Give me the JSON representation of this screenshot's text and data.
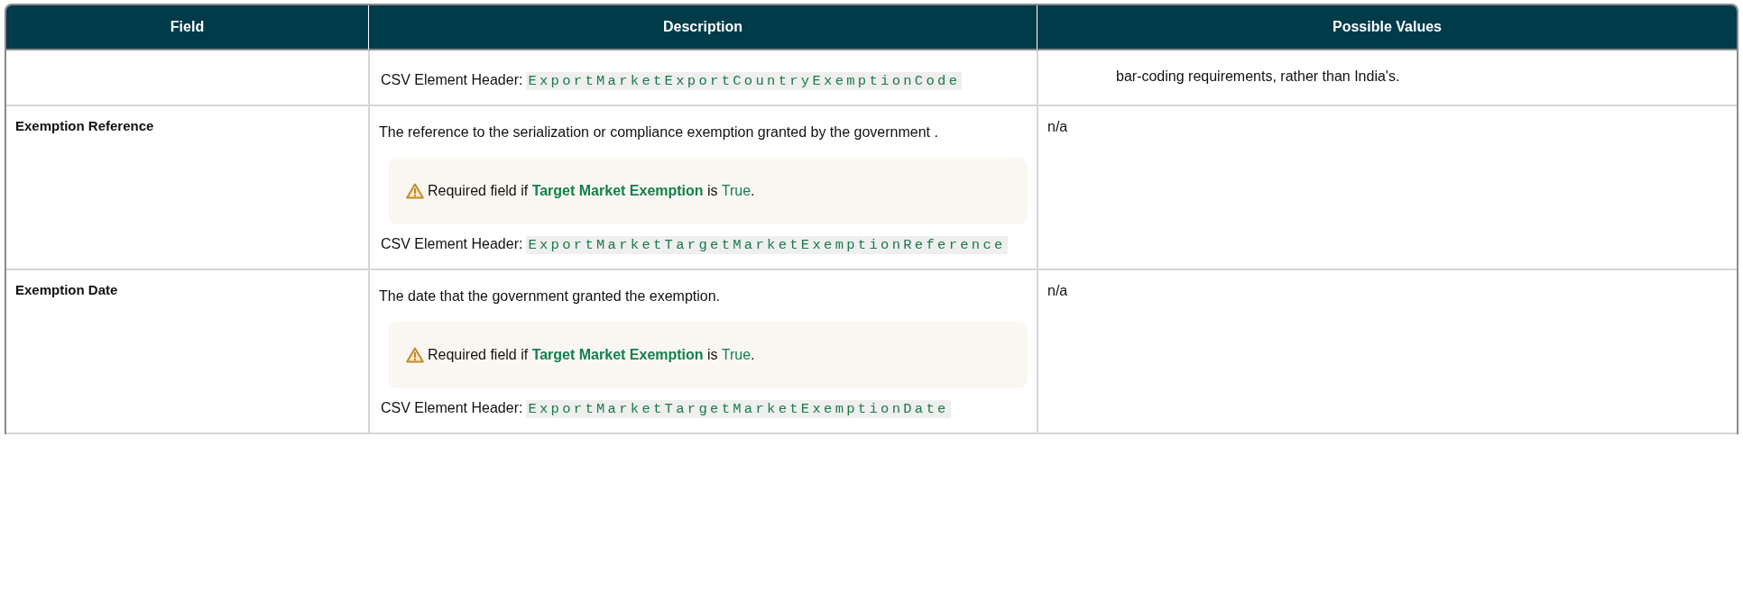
{
  "table": {
    "columns": [
      "Field",
      "Description",
      "Possible Values"
    ],
    "rows": [
      {
        "field": "",
        "description": [
          {
            "kind": "csv",
            "label": "CSV Element Header:",
            "code": "ExportMarketExportCountryExemptionCode"
          }
        ],
        "values": [
          {
            "kind": "continued",
            "text": "bar-coding requirements, rather than India's."
          }
        ]
      },
      {
        "field": "Exemption Reference",
        "description": [
          {
            "kind": "text",
            "text": "The reference to the serialization or compliance exemption granted by the government ."
          },
          {
            "kind": "note",
            "segments": [
              {
                "kind": "plain",
                "text": "Required field if "
              },
              {
                "kind": "term",
                "text": "Target Market Exemption"
              },
              {
                "kind": "plain",
                "text": " is "
              },
              {
                "kind": "value",
                "text": "True"
              },
              {
                "kind": "plain",
                "text": "."
              }
            ]
          },
          {
            "kind": "csv",
            "label": "CSV Element Header:",
            "code": "ExportMarketTargetMarketExemptionReference"
          }
        ],
        "values": [
          {
            "kind": "text",
            "text": "n/a"
          }
        ]
      },
      {
        "field": "Exemption Date",
        "description": [
          {
            "kind": "text",
            "text": "The date that the government granted the exemption."
          },
          {
            "kind": "note",
            "segments": [
              {
                "kind": "plain",
                "text": "Required field if "
              },
              {
                "kind": "term",
                "text": "Target Market Exemption"
              },
              {
                "kind": "plain",
                "text": " is "
              },
              {
                "kind": "value",
                "text": "True"
              },
              {
                "kind": "plain",
                "text": "."
              }
            ]
          },
          {
            "kind": "csv",
            "label": "CSV Element Header:",
            "code": "ExportMarketTargetMarketExemptionDate"
          }
        ],
        "values": [
          {
            "kind": "text",
            "text": "n/a"
          }
        ]
      }
    ]
  }
}
